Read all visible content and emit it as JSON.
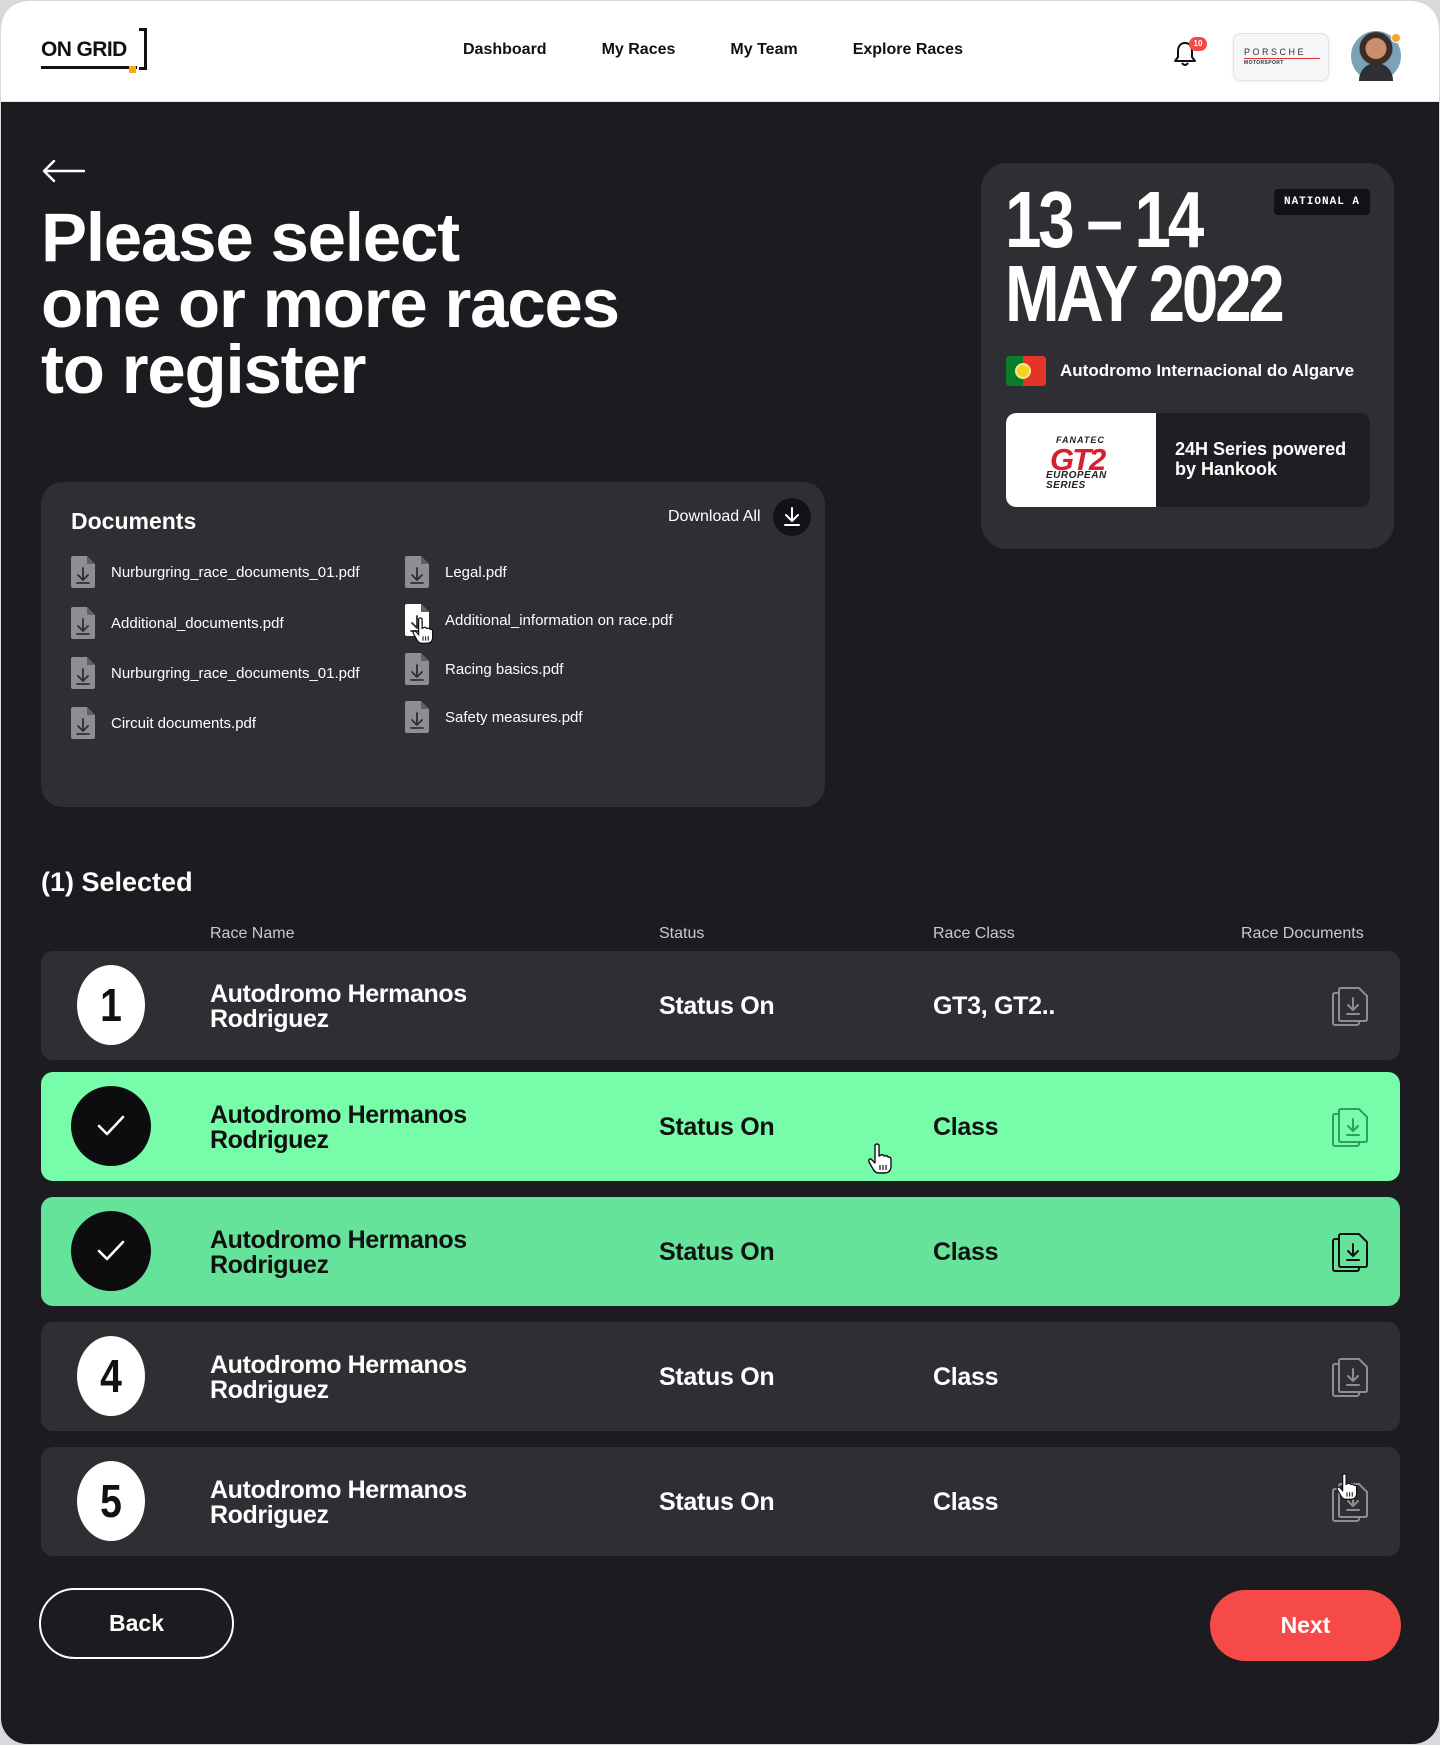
{
  "header": {
    "logo": "ON GRID",
    "nav": [
      "Dashboard",
      "My Races",
      "My Team",
      "Explore Races"
    ],
    "notifications_count": "10",
    "sponsor_wordmark": "PORSCHE",
    "sponsor_sub": "MOTORSPORT"
  },
  "hero": {
    "heading_lines": [
      "Please select",
      "one or more races",
      "to register"
    ]
  },
  "event": {
    "dates_line1": "13 – 14",
    "dates_line2": "MAY 2022",
    "level": "NATIONAL A",
    "venue": "Autodromo Internacional do Algarve",
    "country_flag": "portugal-flag",
    "series_logo": {
      "top": "FANATEC",
      "main": "GT2",
      "bottom_1": "EUROPEAN",
      "bottom_2": "SERIES"
    },
    "series_name": "24H Series powered by Hankook"
  },
  "documents": {
    "title": "Documents",
    "download_all": "Download All",
    "files": [
      "Nurburgring_race_documents_01.pdf",
      "Additional_documents.pdf",
      "Nurburgring_race_documents_01.pdf",
      "Circuit documents.pdf",
      "Legal.pdf",
      "Additional_information on race.pdf",
      "Racing basics.pdf",
      "Safety measures.pdf"
    ]
  },
  "selection": {
    "title": "(1) Selected",
    "columns": [
      "Race Name",
      "Status",
      "Race Class",
      "Race Documents"
    ],
    "rows": [
      {
        "badge": "1",
        "selected": false,
        "race_line1": "Autodromo Hermanos",
        "race_line2": "Rodriguez",
        "status": "Status On",
        "class": "GT3, GT2.."
      },
      {
        "badge": "",
        "selected": true,
        "race_line1": "Autodromo Hermanos",
        "race_line2": "Rodriguez",
        "status": "Status On",
        "class": "Class"
      },
      {
        "badge": "",
        "selected": true,
        "race_line1": "Autodromo Hermanos",
        "race_line2": "Rodriguez",
        "status": "Status On",
        "class": "Class"
      },
      {
        "badge": "4",
        "selected": false,
        "race_line1": "Autodromo Hermanos",
        "race_line2": "Rodriguez",
        "status": "Status On",
        "class": "Class"
      },
      {
        "badge": "5",
        "selected": false,
        "race_line1": "Autodromo Hermanos",
        "race_line2": "Rodriguez",
        "status": "Status On",
        "class": "Class"
      }
    ]
  },
  "footer": {
    "back_label": "Back",
    "next_label": "Next"
  },
  "colors": {
    "background": "#1c1c20",
    "card": "#2e2e33",
    "selected_row": "#77fdaa",
    "selected_row_alt": "#66e39a",
    "accent_red": "#f54a47"
  }
}
